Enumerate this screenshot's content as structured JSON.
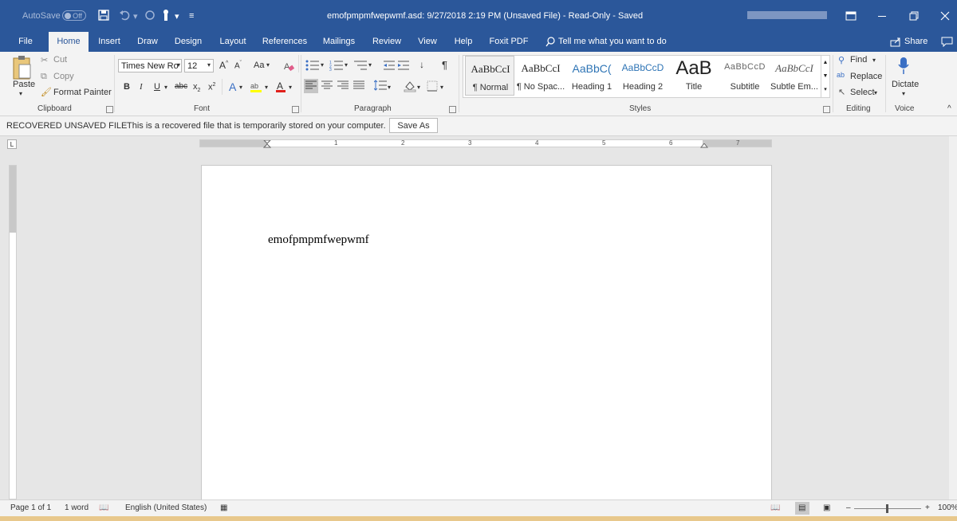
{
  "titlebar": {
    "autosave_label": "AutoSave",
    "autosave_state": "Off",
    "title": "emofpmpmfwepwmf.asd: 9/27/2018 2:19 PM (Unsaved File)  -  Read-Only  -  Saved"
  },
  "tabs": [
    "File",
    "Home",
    "Insert",
    "Draw",
    "Design",
    "Layout",
    "References",
    "Mailings",
    "Review",
    "View",
    "Help",
    "Foxit PDF"
  ],
  "tell_me": "Tell me what you want to do",
  "share_label": "Share",
  "clipboard": {
    "paste": "Paste",
    "cut": "Cut",
    "copy": "Copy",
    "format_painter": "Format Painter",
    "group_label": "Clipboard"
  },
  "font": {
    "name": "Times New Ro",
    "size": "12",
    "case_label": "Aa",
    "bold": "B",
    "italic": "I",
    "underline": "U",
    "strike": "abc",
    "subscript": "x",
    "superscript": "x",
    "group_label": "Font"
  },
  "paragraph": {
    "group_label": "Paragraph"
  },
  "styles": {
    "items": [
      {
        "preview": "AaBbCcI",
        "name": "¶ Normal"
      },
      {
        "preview": "AaBbCcI",
        "name": "¶ No Spac..."
      },
      {
        "preview": "AaBbC(",
        "name": "Heading 1"
      },
      {
        "preview": "AaBbCcD",
        "name": "Heading 2"
      },
      {
        "preview": "AaB",
        "name": "Title"
      },
      {
        "preview": "AaBbCcD",
        "name": "Subtitle"
      },
      {
        "preview": "AaBbCcI",
        "name": "Subtle Em..."
      }
    ],
    "group_label": "Styles"
  },
  "editing": {
    "find": "Find",
    "replace": "Replace",
    "select": "Select",
    "group_label": "Editing"
  },
  "voice": {
    "dictate": "Dictate",
    "group_label": "Voice"
  },
  "message": {
    "heading": "RECOVERED UNSAVED FILE",
    "text": "This is a recovered file that is temporarily stored on your computer.",
    "button": "Save As"
  },
  "ruler_numbers": [
    "1",
    "2",
    "3",
    "4",
    "5",
    "6",
    "7"
  ],
  "document": {
    "body_text": "emofpmpmfwepwmf"
  },
  "status": {
    "page": "Page 1 of 1",
    "words": "1 word",
    "language": "English (United States)",
    "zoom": "100%"
  },
  "colors": {
    "accent": "#2b579a",
    "background": "#e6e6e6",
    "ribbon": "#f3f3f3"
  }
}
